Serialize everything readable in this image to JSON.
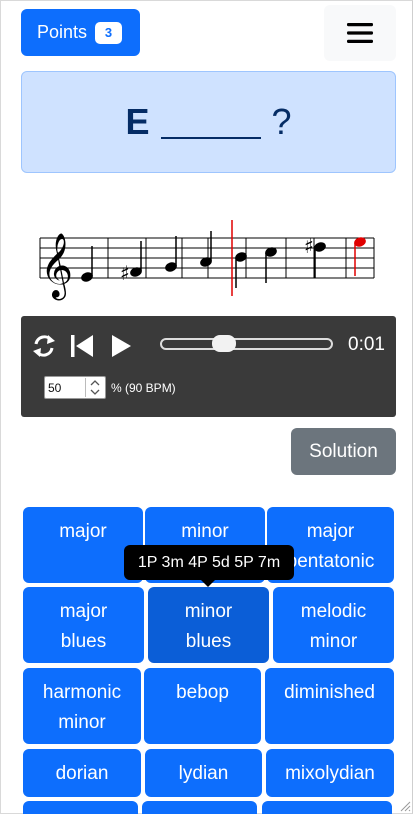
{
  "header": {
    "points_label": "Points",
    "points_count": "3"
  },
  "question": {
    "note": "E",
    "mark": "?"
  },
  "player": {
    "time": "0:01",
    "speed_value": "50",
    "speed_label": "% (90 BPM)",
    "progress": 0.35
  },
  "solution_label": "Solution",
  "tooltip": "1P 3m 4P 5d 5P 7m",
  "scales": [
    {
      "label": "major"
    },
    {
      "label": "minor"
    },
    {
      "label": "major pentatonic"
    },
    {
      "label": "major blues"
    },
    {
      "label": "minor blues"
    },
    {
      "label": "melodic minor"
    },
    {
      "label": "harmonic minor"
    },
    {
      "label": "bebop"
    },
    {
      "label": "diminished"
    },
    {
      "label": "dorian"
    },
    {
      "label": "lydian"
    },
    {
      "label": "mixolydian"
    }
  ],
  "colors": {
    "primary": "#0d6efd",
    "secondary": "#6c757d",
    "alert_bg": "#cfe2ff",
    "player_bg": "#3a3a3a",
    "highlight_note": "#e00000"
  },
  "icons": {
    "menu": "hamburger-icon",
    "repeat": "repeat-icon",
    "back": "skip-back-icon",
    "play": "play-icon"
  }
}
